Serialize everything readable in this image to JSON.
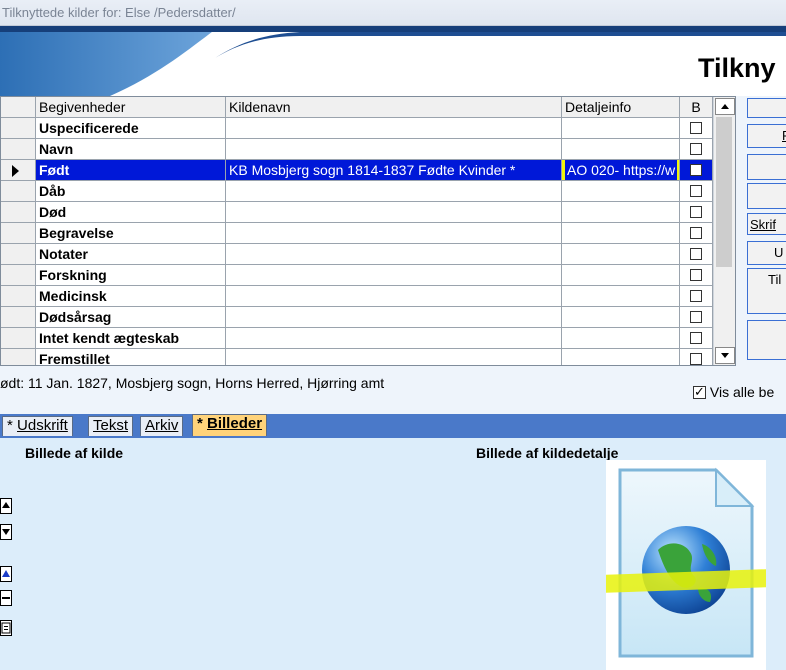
{
  "window": {
    "title": "Tilknyttede kilder for: Else /Pedersdatter/"
  },
  "banner": {
    "heading": "Tilkny"
  },
  "grid": {
    "headers": [
      "Begivenheder",
      "Kildenavn",
      "Detaljeinfo",
      "B"
    ],
    "rows": [
      {
        "event": "Uspecificerede",
        "source": "",
        "detail": ""
      },
      {
        "event": "Navn",
        "source": "",
        "detail": ""
      },
      {
        "event": "Født",
        "source": "KB Mosbjerg sogn 1814-1837 Fødte Kvinder *",
        "detail": "AO 020- https://w"
      },
      {
        "event": "Dåb",
        "source": "",
        "detail": ""
      },
      {
        "event": "Død",
        "source": "",
        "detail": ""
      },
      {
        "event": "Begravelse",
        "source": "",
        "detail": ""
      },
      {
        "event": "Notater",
        "source": "",
        "detail": ""
      },
      {
        "event": "Forskning",
        "source": "",
        "detail": ""
      },
      {
        "event": "Medicinsk",
        "source": "",
        "detail": ""
      },
      {
        "event": "Dødsårsag",
        "source": "",
        "detail": ""
      },
      {
        "event": "Intet kendt ægteskab",
        "source": "",
        "detail": ""
      },
      {
        "event": "Fremstillet",
        "source": "",
        "detail": ""
      }
    ]
  },
  "right_buttons": [
    "",
    "F",
    "",
    "",
    "Skrif",
    "U",
    "Til",
    ""
  ],
  "status": {
    "text": "ødt: 11 Jan. 1827, Mosbjerg sogn, Horns Herred, Hjørring amt"
  },
  "vis_alle": {
    "label": "Vis alle be"
  },
  "tabs": [
    {
      "prefix": "* ",
      "label": "Udskrift"
    },
    {
      "prefix": "",
      "label": "Tekst"
    },
    {
      "prefix": "",
      "label": "Arkiv"
    },
    {
      "prefix": "* ",
      "label": "Billeder"
    }
  ],
  "lower": {
    "left_label": "Billede af kilde",
    "right_label": "Billede af kildedetalje"
  },
  "colors": {
    "selection": "#0018d8",
    "highlight": "#f0f50c",
    "tab_active": "#ffd37a",
    "tabstrip": "#4a79c9"
  }
}
